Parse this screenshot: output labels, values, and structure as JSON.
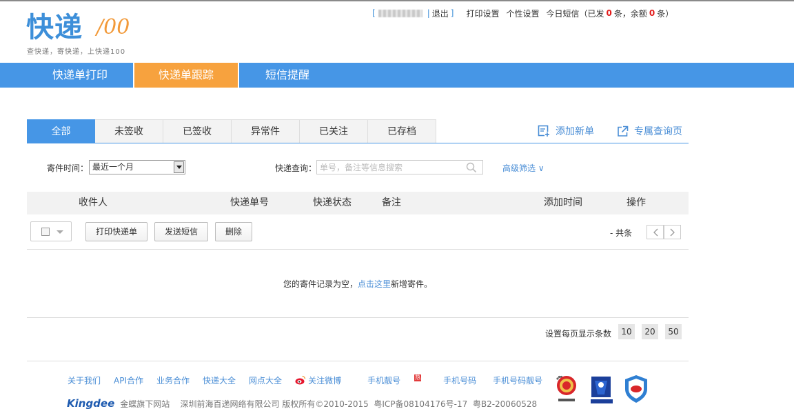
{
  "logo": {
    "main": "快递",
    "num": "/00",
    "slogan": "查快递，寄快递，上快递100"
  },
  "topbar": {
    "open": "[",
    "close": "]",
    "logout": "退出",
    "print_settings": "打印设置",
    "personal_settings": "个性设置",
    "sms_prefix": "今日短信（已发",
    "sent": "0",
    "sms_mid": "条，余额",
    "balance": "0",
    "sms_suffix": "条）"
  },
  "nav": {
    "items": [
      "快递单打印",
      "快递单跟踪",
      "短信提醒"
    ],
    "active": 1
  },
  "tabs": {
    "items": [
      "全部",
      "未签收",
      "已签收",
      "异常件",
      "已关注",
      "已存档"
    ],
    "active": 0
  },
  "actions": {
    "add": "添加新单",
    "query": "专属查询页"
  },
  "filter": {
    "time_label": "寄件时间：",
    "time_value": "最近一个月",
    "query_label": "快递查询：",
    "query_placeholder": "单号，备注等信息搜索",
    "advanced": "高级筛选 ∨"
  },
  "table": {
    "headers": [
      "收件人",
      "快递单号",
      "快递状态",
      "备注",
      "添加时间",
      "操作"
    ]
  },
  "buttons": {
    "print": "打印快递单",
    "sms": "发送短信",
    "delete": "删除"
  },
  "pagination": {
    "info": "-  共条",
    "prev": "<",
    "next": ">"
  },
  "empty": {
    "prefix": "您的寄件记录为空，",
    "link": "点击这里",
    "suffix": "新增寄件。"
  },
  "per_page": {
    "label": "设置每页显示条数",
    "options": [
      "10",
      "20",
      "50"
    ]
  },
  "footer": {
    "links": [
      "关于我们",
      "API合作",
      "业务合作",
      "快递大全",
      "网点大全",
      "关注微博",
      "手机靓号",
      "手机号码",
      "手机号码靓号"
    ],
    "hot": "热",
    "kingdee": "Kingdee",
    "copy": "金蝶旗下网站    深圳前海百递网络有限公司 版权所有©2010-2015  粤ICP备08104176号-17  粤B2-20060528"
  },
  "colors": {
    "primary": "#4696e6",
    "accent": "#f7a23e",
    "link": "#4a8ed6",
    "alert": "#e21b1b"
  }
}
